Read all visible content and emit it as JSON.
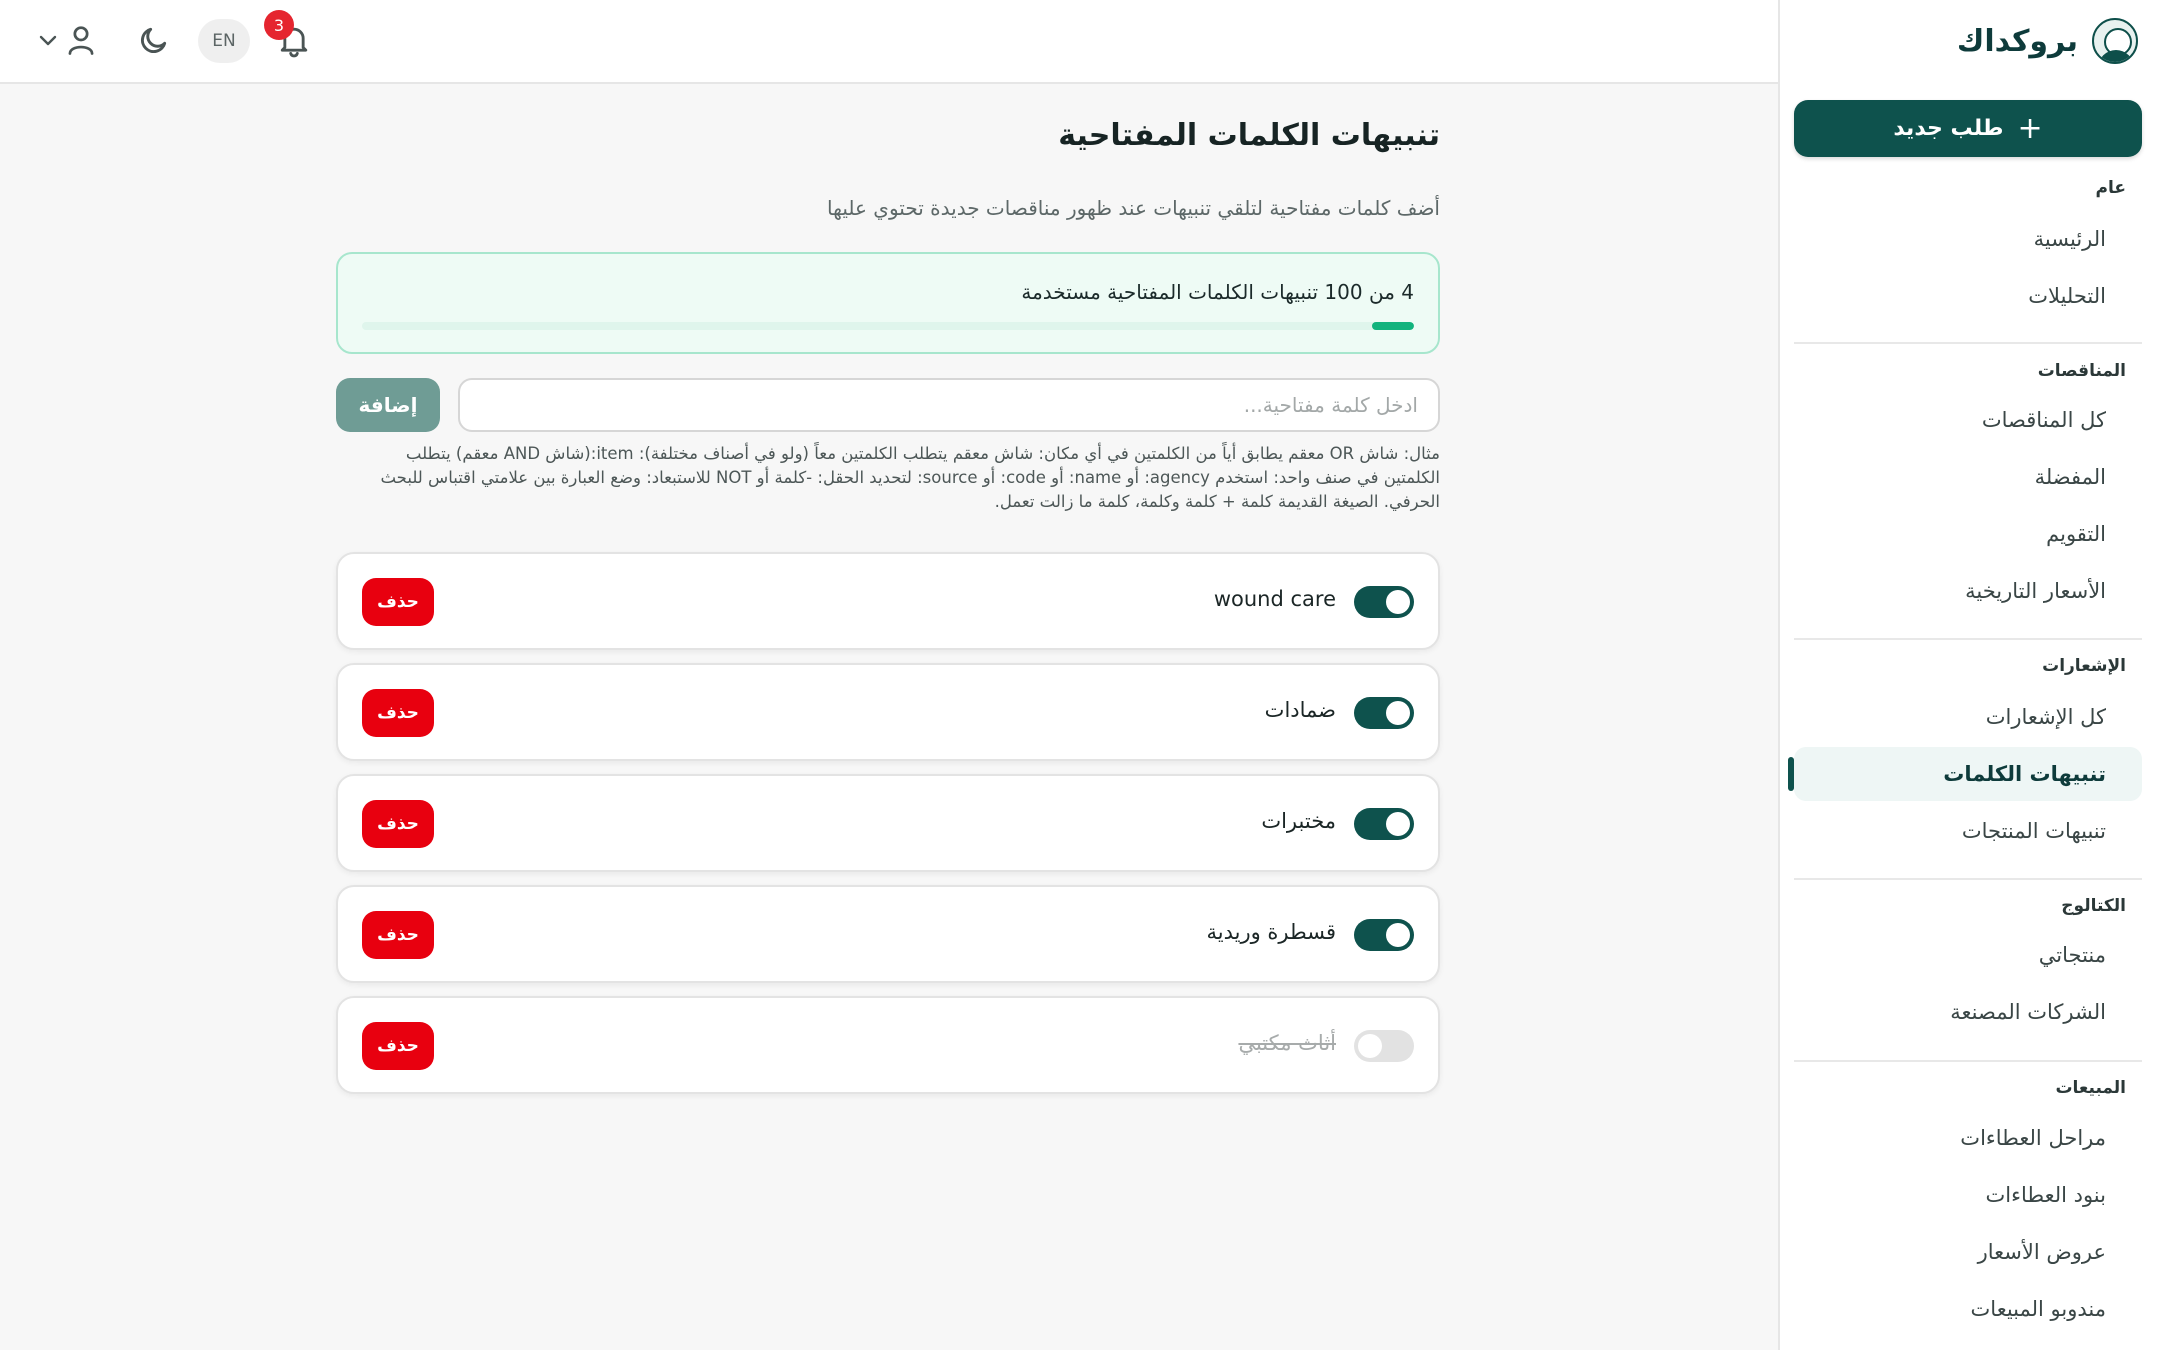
{
  "brand": {
    "name": "بروكداك"
  },
  "sidebar": {
    "new_request": "طلب جديد",
    "sections": [
      {
        "title": "عام",
        "items": [
          "الرئيسية",
          "التحليلات"
        ]
      },
      {
        "title": "المناقصات",
        "items": [
          "كل المناقصات",
          "المفضلة",
          "التقويم",
          "الأسعار التاريخية"
        ]
      },
      {
        "title": "الإشعارات",
        "items": [
          "كل الإشعارات",
          "تنبيهات الكلمات",
          "تنبيهات المنتجات"
        ]
      },
      {
        "title": "الكتالوج",
        "items": [
          "منتجاتي",
          "الشركات المصنعة"
        ]
      },
      {
        "title": "المبيعات",
        "items": [
          "مراحل العطاءات",
          "بنود العطاءات",
          "عروض الأسعار",
          "مندوبو المبيعات"
        ]
      }
    ],
    "active_item": "تنبيهات الكلمات"
  },
  "topbar": {
    "language": "EN",
    "notification_count": "3"
  },
  "page": {
    "title": "تنبيهات الكلمات المفتاحية",
    "subtitle": "أضف كلمات مفتاحية لتلقي تنبيهات عند ظهور مناقصات جديدة تحتوي عليها",
    "usage_text": "4 من 100 تنبيهات الكلمات المفتاحية مستخدمة",
    "usage_used": 4,
    "usage_limit": 100,
    "input_placeholder": "ادخل كلمة مفتاحية...",
    "add_label": "إضافة",
    "hint": "مثال: شاش OR معقم يطابق أياً من الكلمتين في أي مكان: شاش معقم يتطلب الكلمتين معاً (ولو في أصناف مختلفة): item:(شاش AND معقم) يتطلب الكلمتين في صنف واحد: استخدم agency: أو name: أو code: أو source: لتحديد الحقل: -كلمة أو NOT للاستبعاد: وضع العبارة بين علامتي اقتباس للبحث الحرفي. الصيغة القديمة كلمة + كلمة وكلمة، كلمة ما زالت تعمل.",
    "delete_label": "حذف"
  },
  "keywords": [
    {
      "text": "wound care",
      "enabled": true
    },
    {
      "text": "ضمادات",
      "enabled": true
    },
    {
      "text": "مختبرات",
      "enabled": true
    },
    {
      "text": "قسطرة وريدية",
      "enabled": true
    },
    {
      "text": "أثاث مكتبي",
      "enabled": false
    }
  ],
  "colors": {
    "brand": "#0e524d",
    "progress": "#12b37d",
    "danger": "#e8000f",
    "badge": "#e5252f"
  }
}
